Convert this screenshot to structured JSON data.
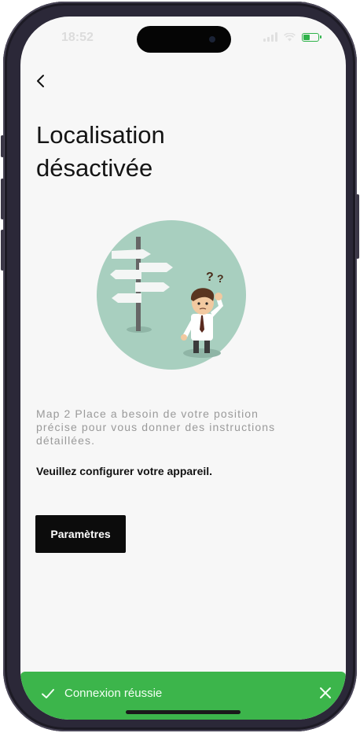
{
  "status": {
    "time": "18:52"
  },
  "page": {
    "title_line1": "Localisation",
    "title_line2": "désactivée",
    "description": "Map 2 Place a besoin de votre position précise pour vous donner des instructions détaillées.",
    "instruction": "Veuillez configurer votre appareil.",
    "settings_label": "Paramètres"
  },
  "toast": {
    "message": "Connexion réussie"
  },
  "icons": {
    "back": "chevron-left-icon",
    "toast_status": "check-icon",
    "toast_close": "close-icon",
    "illustration": "lost-person-signpost-illustration"
  },
  "colors": {
    "toast_bg": "#3cb54b",
    "button_bg": "#0c0c0c",
    "illustration_circle": "#a8cfbf",
    "battery": "#2fb34a"
  }
}
